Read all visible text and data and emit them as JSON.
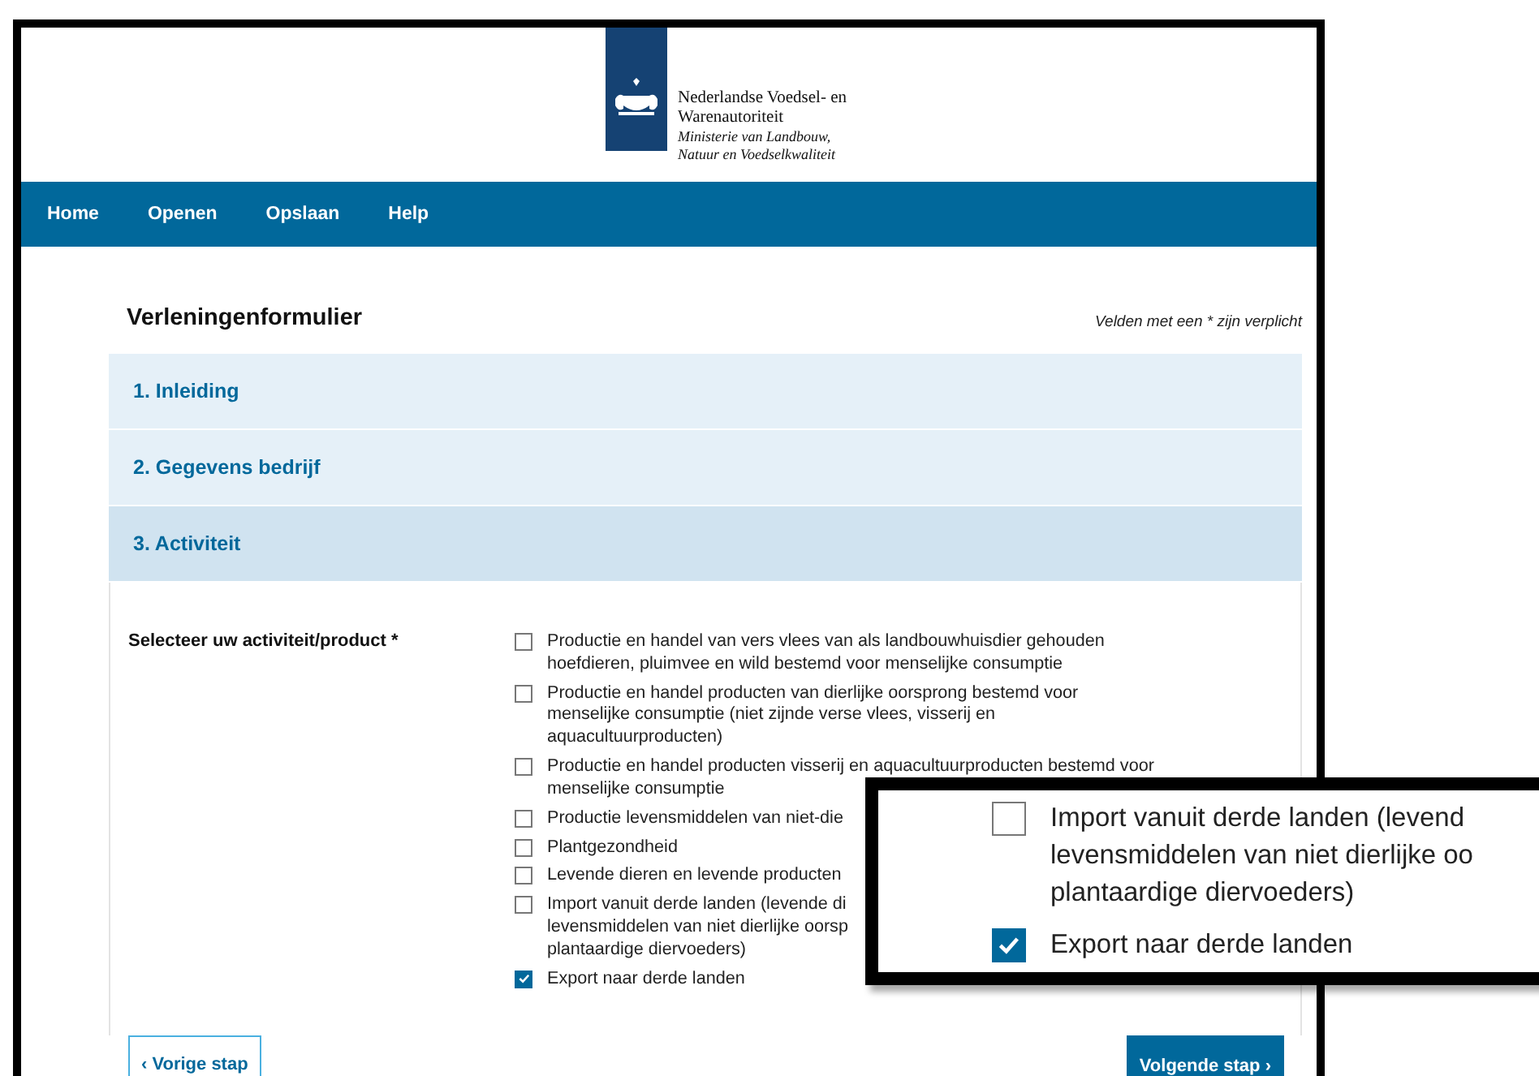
{
  "header": {
    "org_lines": [
      "Nederlandse Voedsel- en",
      "Warenautoriteit"
    ],
    "ministry_lines": [
      "Ministerie van Landbouw,",
      "Natuur en Voedselkwaliteit"
    ]
  },
  "nav": [
    "Home",
    "Openen",
    "Opslaan",
    "Help"
  ],
  "form": {
    "title": "Verleningenformulier",
    "required_note": "Velden met een * zijn verplicht",
    "sections": [
      {
        "label": "1. Inleiding",
        "expanded": false
      },
      {
        "label": "2. Gegevens bedrijf",
        "expanded": false
      },
      {
        "label": "3. Activiteit",
        "expanded": true
      }
    ],
    "field_label": "Selecteer uw activiteit/product *",
    "options": [
      {
        "lines": [
          "Productie en handel van vers vlees van als landbouwhuisdier gehouden",
          "hoefdieren, pluimvee en wild bestemd voor menselijke consumptie"
        ],
        "checked": false
      },
      {
        "lines": [
          "Productie en handel producten van dierlijke oorsprong bestemd voor",
          "menselijke consumptie (niet zijnde verse vlees, visserij en",
          "aquacultuurproducten)"
        ],
        "checked": false
      },
      {
        "lines": [
          "Productie en handel producten visserij en aquacultuurproducten bestemd voor",
          "menselijke consumptie"
        ],
        "checked": false
      },
      {
        "lines": [
          "Productie levensmiddelen van niet-die"
        ],
        "checked": false
      },
      {
        "lines": [
          "Plantgezondheid"
        ],
        "checked": false
      },
      {
        "lines": [
          "Levende dieren en levende producten"
        ],
        "checked": false
      },
      {
        "lines": [
          "Import vanuit derde landen (levende di",
          "levensmiddelen van niet dierlijke oorsp",
          "plantaardige diervoeders)"
        ],
        "checked": false
      },
      {
        "lines": [
          "Export naar derde landen"
        ],
        "checked": true
      }
    ],
    "prev_button": "‹ Vorige stap",
    "next_button": "Volgende stap ›"
  },
  "callout": {
    "options": [
      {
        "lines": [
          "Import vanuit derde landen (levend",
          "levensmiddelen van niet dierlijke oo",
          "plantaardige diervoeders)"
        ],
        "checked": false
      },
      {
        "lines": [
          "Export naar derde landen"
        ],
        "checked": true
      }
    ]
  }
}
